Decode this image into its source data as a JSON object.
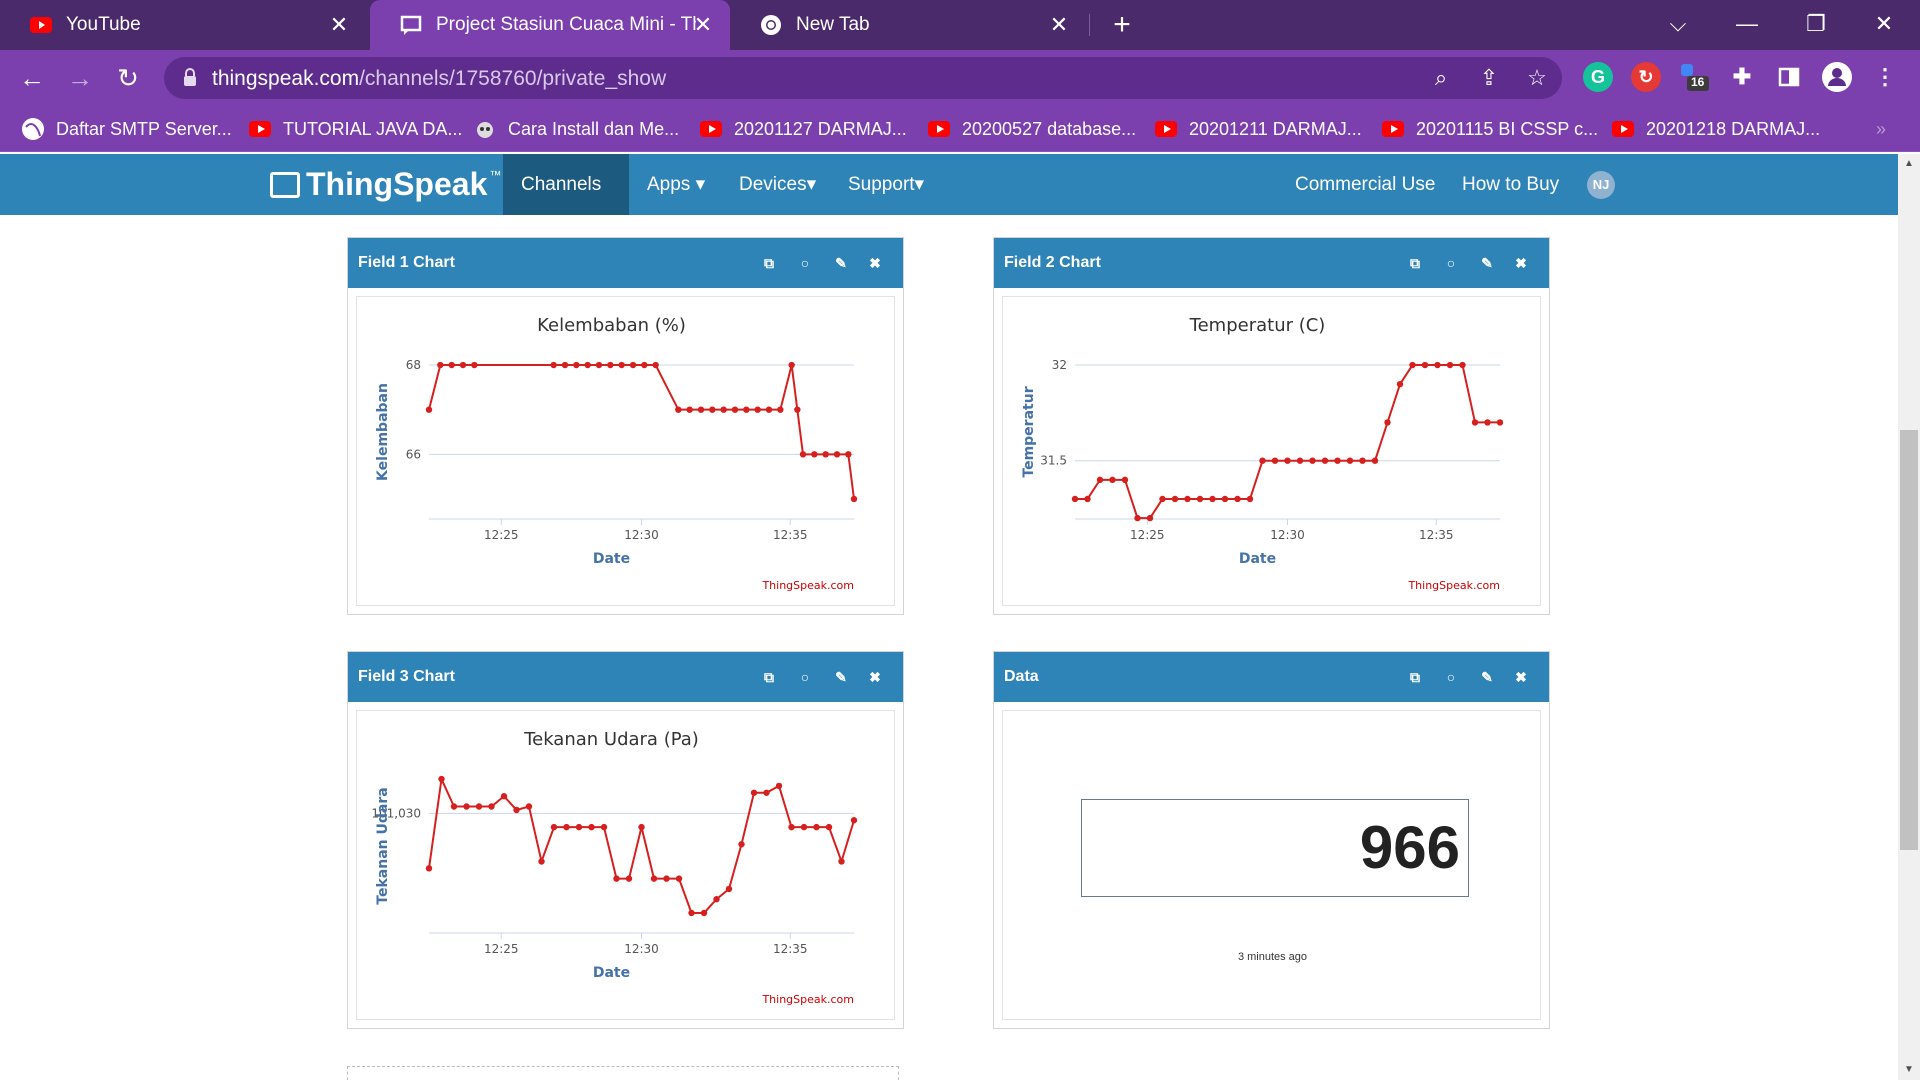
{
  "browser": {
    "tabs": [
      {
        "title": "YouTube"
      },
      {
        "title": "Project Stasiun Cuaca Mini - Thin"
      },
      {
        "title": "New Tab"
      }
    ],
    "url_host": "thingspeak.com",
    "url_path": "/channels/1758760/private_show",
    "extension_badge": "16",
    "bookmarks": [
      {
        "label": "Daftar SMTP Server..."
      },
      {
        "label": "TUTORIAL JAVA DA..."
      },
      {
        "label": "Cara Install dan Me..."
      },
      {
        "label": "20201127 DARMAJ..."
      },
      {
        "label": "20200527 database..."
      },
      {
        "label": "20201211 DARMAJ..."
      },
      {
        "label": "20201115 BI CSSP c..."
      },
      {
        "label": "20201218 DARMAJ..."
      }
    ]
  },
  "nav": {
    "logo": "ThingSpeak",
    "logo_tm": "™",
    "items": {
      "channels": "Channels",
      "apps": "Apps",
      "devices": "Devices",
      "support": "Support",
      "commercial": "Commercial Use",
      "how_to_buy": "How to Buy"
    },
    "avatar": "NJ"
  },
  "widgets": {
    "field1": {
      "title": "Field 1 Chart"
    },
    "field2": {
      "title": "Field 2 Chart"
    },
    "field3": {
      "title": "Field 3 Chart"
    },
    "data": {
      "title": "Data",
      "value": "966",
      "ago": "3 minutes ago"
    }
  },
  "colors": {
    "line": "#d62020",
    "header": "#2e83b7",
    "accent": "#7b3fae"
  },
  "chart_data": [
    {
      "id": "field1",
      "type": "line",
      "title": "Kelembaban (%)",
      "xlabel": "Date",
      "ylabel": "Kelembaban",
      "credit": "ThingSpeak.com",
      "x_ticks": [
        "12:25",
        "12:30",
        "12:35"
      ],
      "y_ticks": [
        {
          "v": 68,
          "label": "68"
        },
        {
          "v": 66,
          "label": "66"
        }
      ],
      "ylim": [
        65,
        68
      ],
      "xlim": [
        12.37,
        12.62
      ],
      "x": [
        12.37,
        12.38,
        12.39,
        12.4,
        12.41,
        12.48,
        12.49,
        12.5,
        12.51,
        12.52,
        12.53,
        12.54,
        12.55,
        12.56,
        12.57,
        12.59,
        12.6,
        12.61,
        12.62,
        12.63,
        12.64,
        12.65,
        12.66,
        12.67,
        12.68,
        12.69,
        12.695,
        12.7,
        12.71,
        12.72,
        12.73,
        12.74,
        12.745
      ],
      "y": [
        67,
        68,
        68,
        68,
        68,
        68,
        68,
        68,
        68,
        68,
        68,
        68,
        68,
        68,
        68,
        67,
        67,
        67,
        67,
        67,
        67,
        67,
        67,
        67,
        67,
        68,
        67,
        66,
        66,
        66,
        66,
        66,
        65
      ]
    },
    {
      "id": "field2",
      "type": "line",
      "title": "Temperatur (C)",
      "xlabel": "Date",
      "ylabel": "Temperatur",
      "credit": "ThingSpeak.com",
      "x_ticks": [
        "12:25",
        "12:30",
        "12:35"
      ],
      "y_ticks": [
        {
          "v": 32,
          "label": "32"
        },
        {
          "v": 31.5,
          "label": "31.5"
        }
      ],
      "ylim": [
        31.3,
        32
      ],
      "x": [
        1,
        2,
        3,
        4,
        5,
        6,
        7,
        8,
        9,
        10,
        11,
        12,
        13,
        14,
        15,
        16,
        17,
        18,
        19,
        20,
        21,
        22,
        23,
        24,
        25,
        26,
        27,
        28,
        29,
        30,
        31,
        32,
        33,
        34,
        35
      ],
      "y": [
        31.3,
        31.3,
        31.4,
        31.4,
        31.4,
        31.2,
        31.2,
        31.3,
        31.3,
        31.3,
        31.3,
        31.3,
        31.3,
        31.3,
        31.3,
        31.5,
        31.5,
        31.5,
        31.5,
        31.5,
        31.5,
        31.5,
        31.5,
        31.5,
        31.5,
        31.7,
        31.9,
        32,
        32,
        32,
        32,
        32,
        31.7,
        31.7,
        31.7
      ]
    },
    {
      "id": "field3",
      "type": "line",
      "title": "Tekanan Udara (Pa)",
      "xlabel": "Date",
      "ylabel": "Tekanan Udara",
      "credit": "ThingSpeak.com",
      "x_ticks": [
        "12:25",
        "12:30",
        "12:35"
      ],
      "y_ticks": [
        {
          "v": 101030,
          "label": "101,030"
        }
      ],
      "y": [
        101014,
        101040,
        101032,
        101032,
        101032,
        101032,
        101035,
        101031,
        101032,
        101016,
        101026,
        101026,
        101026,
        101026,
        101026,
        101011,
        101011,
        101026,
        101011,
        101011,
        101011,
        101001,
        101001,
        101005,
        101008,
        101021,
        101036,
        101036,
        101038,
        101026,
        101026,
        101026,
        101026,
        101016,
        101028
      ]
    }
  ]
}
